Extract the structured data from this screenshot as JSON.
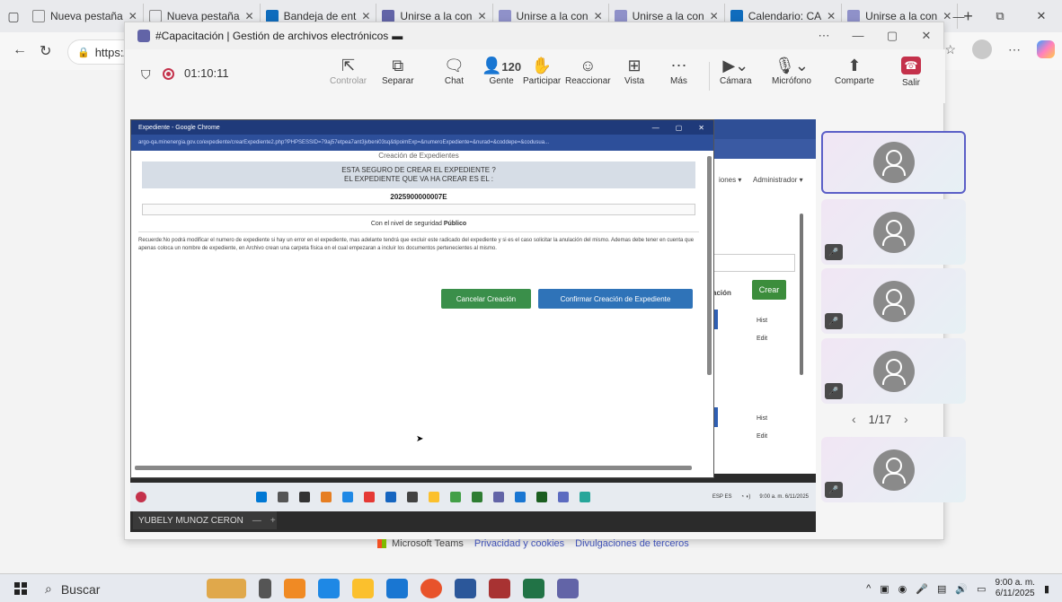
{
  "browser": {
    "tabs": [
      {
        "label": "Nueva pestaña",
        "color": "#888888"
      },
      {
        "label": "Nueva pestaña",
        "color": "#888888"
      },
      {
        "label": "Bandeja de ent",
        "color": "#0f6cbd"
      },
      {
        "label": "Unirse a la con",
        "color": "#6264a7"
      },
      {
        "label": "Unirse a la con",
        "color": "#6264a7"
      },
      {
        "label": "Unirse a la con",
        "color": "#6264a7"
      },
      {
        "label": "Calendario: CA",
        "color": "#0f6cbd"
      },
      {
        "label": "Unirse a la con",
        "color": "#6264a7"
      }
    ],
    "address": "https:/",
    "win_minimize": "—",
    "win_restore": "⧉",
    "win_close": "✕"
  },
  "teams": {
    "window_title": "#Capacitación | Gestión de archivos electrónicos",
    "timer": "01:10:11",
    "controls": {
      "controlar": "Controlar",
      "separar": "Separar",
      "chat": "Chat",
      "gente_count": "120",
      "gente": "Gente",
      "participar": "Participar",
      "reaccionar": "Reaccionar",
      "vista": "Vista",
      "mas": "Más",
      "camara": "Cámara",
      "microfono": "Micrófono",
      "comparte": "Comparte",
      "salir": "Salir"
    },
    "presenter_name": "YUBELY MUNOZ CERON",
    "pager": "1/17",
    "footer": {
      "ms": "Microsoft Teams",
      "privacy": "Privacidad y cookies",
      "disclosures": "Divulgaciones de terceros"
    }
  },
  "shared_screen": {
    "chrome_title": "Expediente - Google Chrome",
    "chrome_url": "argo-qa.minenergia.gov.co/expediente/crearExpediente2.php?PHPSESSID=79aj57etpea7ant3jvbeni03sq&tipoimExp=&numeroExpediente=&nurad=&coddepe=&codusua...",
    "page_subtitle": "Creación de Expedientes",
    "confirm_line1": "ESTA SEGURO DE CREAR EL EXPEDIENTE ?",
    "confirm_line2": "EL EXPEDIENTE QUE VA HA CREAR ES EL :",
    "expediente_numero": "2025900000007E",
    "nivel_prefix": "Con el nivel de seguridad",
    "nivel_value": "Público",
    "recuerde": "Recuerde:No podrá modificar el numero de expediente si hay un error en el expediente, mas adelante tendrá que excluir este radicado del expediente y si es el caso solicitar la anulación del mismo. Ademas debe tener en cuenta que apenas coloca un nombre de expediente, en Archivo crean una carpeta física en el cual empezaran a incluir los documentos pertenecientes al mismo.",
    "btn_cancel": "Cancelar Creación",
    "btn_confirm": "Confirmar Creación de Expediente",
    "bg_menu": "iones ▾",
    "bg_admin": "Administrador ▾",
    "bg_col": "ación",
    "bg_crear": "Crear",
    "bg_hist": "Hist",
    "bg_edit": "Edit",
    "inner_clock_time": "9:00 a. m.",
    "inner_clock_date": "6/11/2025",
    "inner_lang": "ESP ES"
  },
  "taskbar": {
    "search": "Buscar",
    "time": "9:00 a. m.",
    "date": "6/11/2025"
  }
}
